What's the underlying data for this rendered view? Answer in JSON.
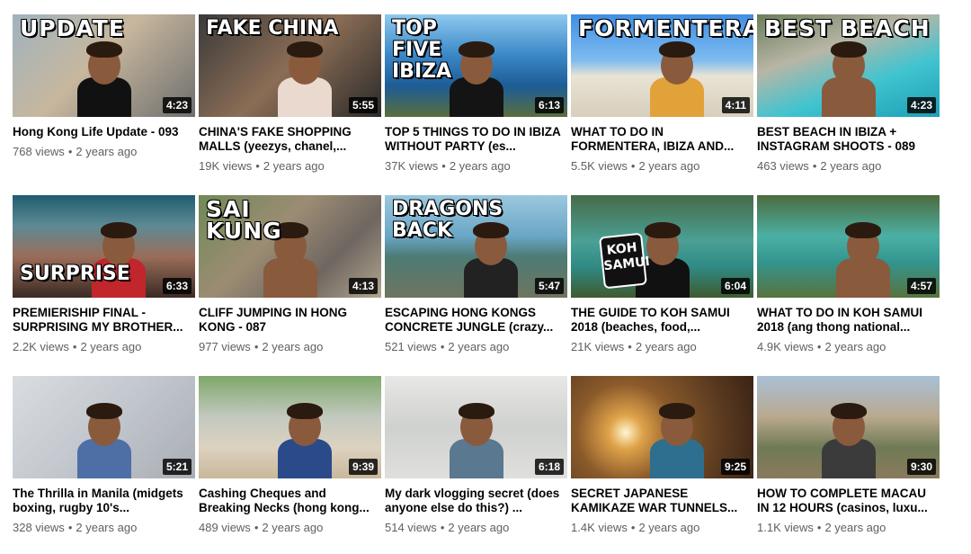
{
  "videos": [
    {
      "title": "Hong Kong Life Update - 093",
      "views": "768 views",
      "age": "2 years ago",
      "duration": "4:23",
      "overlay": "UPDATE",
      "bg": "linear-gradient(135deg,#9fb3c0 0%,#c7b79d 45%,#6e6e6e 100%)",
      "shirt": "#111111"
    },
    {
      "title": "CHINA'S FAKE SHOPPING MALLS (yeezys, chanel,...",
      "views": "19K views",
      "age": "2 years ago",
      "duration": "5:55",
      "overlay": "FAKE  CHINA",
      "bg": "linear-gradient(135deg,#3a3a3a 0%,#8b6d55 50%,#2a2a2a 100%)",
      "shirt": "#e9d9cf"
    },
    {
      "title": "TOP 5 THINGS TO DO IN IBIZA WITHOUT PARTY (es...",
      "views": "37K views",
      "age": "2 years ago",
      "duration": "6:13",
      "overlay": "TOP\nFIVE\nIBIZA",
      "bg": "linear-gradient(180deg,#8ec9f0 0%,#3a87c6 40%,#1d5c95 70%,#5a6e3c 100%)",
      "shirt": "#141414"
    },
    {
      "title": "WHAT TO DO IN FORMENTERA, IBIZA AND...",
      "views": "5.5K views",
      "age": "2 years ago",
      "duration": "4:11",
      "overlay": "FORMENTERA",
      "bg": "linear-gradient(180deg,#3f8fe3 0%,#7fbcf0 45%,#e8e3d5 60%,#d8cfbc 100%)",
      "shirt": "#e1a23a"
    },
    {
      "title": "BEST BEACH IN IBIZA + INSTAGRAM SHOOTS - 089",
      "views": "463 views",
      "age": "2 years ago",
      "duration": "4:23",
      "overlay": "BEST BEACH",
      "bg": "linear-gradient(160deg,#6a7d5a 0%,#b8b6a6 35%,#40c4d0 65%,#1b9fb6 100%)",
      "shirt": ""
    },
    {
      "title": "PREMIERISHIP FINAL - SURPRISING MY BROTHER...",
      "views": "2.2K views",
      "age": "2 years ago",
      "duration": "6:33",
      "overlay": "\n\n\nSURPRISE",
      "bg": "linear-gradient(180deg,#1f5d6e 0%,#5e8a94 30%,#9a6d59 60%,#3b2a24 100%)",
      "shirt": "#c0262c"
    },
    {
      "title": "CLIFF JUMPING IN HONG KONG - 087",
      "views": "977 views",
      "age": "2 years ago",
      "duration": "4:13",
      "overlay": "SAI\nKUNG",
      "bg": "linear-gradient(135deg,#6f8a56 0%,#9c8c74 40%,#6e6660 70%,#b3a58e 100%)",
      "shirt": ""
    },
    {
      "title": "ESCAPING HONG KONGS CONCRETE JUNGLE (crazy...",
      "views": "521 views",
      "age": "2 years ago",
      "duration": "5:47",
      "overlay": "DRAGONS BACK",
      "bg": "linear-gradient(180deg,#9cc8de 0%,#6aa6c6 40%,#4d7b74 60%,#6f7460 100%)",
      "shirt": "#222222"
    },
    {
      "title": "THE GUIDE TO KOH SAMUI 2018 (beaches, food,...",
      "views": "21K views",
      "age": "2 years ago",
      "duration": "6:04",
      "overlay": "",
      "bg": "linear-gradient(180deg,#476b48 0%,#4aa095 45%,#2f8a85 70%,#3f5a2e 100%)",
      "shirt": "#111111",
      "sign": "KOH\nSAMUI"
    },
    {
      "title": "WHAT TO DO IN KOH SAMUI 2018 (ang thong national...",
      "views": "4.9K views",
      "age": "2 years ago",
      "duration": "4:57",
      "overlay": "",
      "bg": "linear-gradient(180deg,#4d6b3e 0%,#4bb0a4 40%,#32958f 65%,#58733d 100%)",
      "shirt": ""
    },
    {
      "title": "The Thrilla in Manila (midgets boxing, rugby 10's...",
      "views": "328 views",
      "age": "2 years ago",
      "duration": "5:21",
      "overlay": "",
      "bg": "linear-gradient(135deg,#d9dde2 0%,#c2c7cd 50%,#a9aeb4 100%)",
      "shirt": "#4d6fa6"
    },
    {
      "title": "Cashing Cheques and Breaking Necks (hong kong...",
      "views": "489 views",
      "age": "2 years ago",
      "duration": "9:39",
      "overlay": "",
      "bg": "linear-gradient(180deg,#7ea86a 0%,#c3c9bf 40%,#dcd2c0 70%,#c9b79a 100%)",
      "shirt": "#2a4a8a"
    },
    {
      "title": "My dark vlogging secret (does anyone else do this?) ...",
      "views": "514 views",
      "age": "2 years ago",
      "duration": "6:18",
      "overlay": "",
      "bg": "linear-gradient(180deg,#e8e8e6 0%,#cfd1cf 50%,#dfe0dd 100%)",
      "shirt": "#5a7890"
    },
    {
      "title": "SECRET JAPANESE KAMIKAZE WAR TUNNELS...",
      "views": "1.4K views",
      "age": "2 years ago",
      "duration": "9:25",
      "overlay": "",
      "bg": "radial-gradient(circle at 30% 55%,#fff6d0 0%,#e0a34a 12%,#8a5a2a 35%,#5a3a20 70%,#3a2414 100%)",
      "shirt": "#2e6e8e"
    },
    {
      "title": "HOW TO COMPLETE MACAU IN 12 HOURS (casinos, luxu...",
      "views": "1.1K views",
      "age": "2 years ago",
      "duration": "9:30",
      "overlay": "",
      "bg": "linear-gradient(180deg,#a9c0d6 0%,#b9a98e 40%,#6f7a55 70%,#8a7a5e 100%)",
      "shirt": "#3b3b3b"
    }
  ]
}
